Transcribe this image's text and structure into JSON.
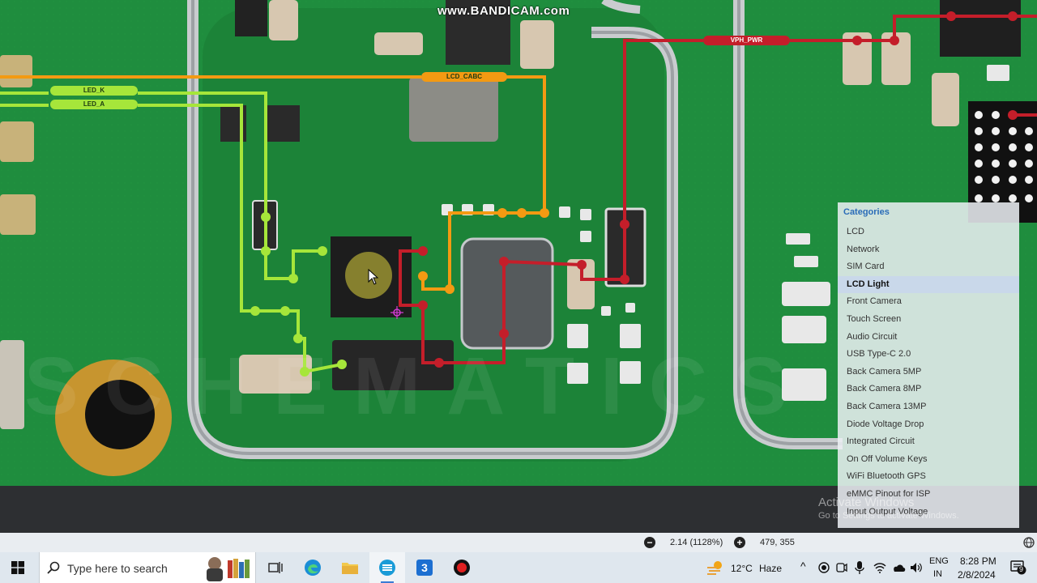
{
  "watermark": "www.BANDICAM.com",
  "background_watermark": "SCHEMATICS",
  "net_labels": {
    "led_k": "LED_K",
    "led_a": "LED_A",
    "lcd_cabc": "LCD_CABC",
    "vph_pwr": "VPH_PWR"
  },
  "colors": {
    "pcb": "#1e8a3c",
    "trace_orange": "#f39a12",
    "trace_green": "#a6e63a",
    "trace_red": "#c41e2a",
    "accent_blue": "#2a6cb8"
  },
  "categories": {
    "title": "Categories",
    "selected": "LCD Light",
    "items": [
      "LCD",
      "Network",
      "SIM Card",
      "LCD Light",
      "Front Camera",
      "Touch Screen",
      "Audio Circuit",
      "USB Type-C 2.0",
      "Back Camera 5MP",
      "Back Camera 8MP",
      "Back Camera 13MP",
      "Diode Voltage Drop",
      "Integrated Circuit",
      "On Off Volume Keys",
      "WiFi Bluetooth GPS",
      "eMMC Pinout for ISP",
      "Input Output Voltage"
    ]
  },
  "status_bar": {
    "zoom_out_icon": "minus-circle-icon",
    "zoom_in_icon": "plus-circle-icon",
    "zoom": "2.14 (1128%)",
    "coordinates": "479, 355"
  },
  "activate_windows": {
    "line1": "Activate Windows",
    "line2": "Go to Settings to activate Windows."
  },
  "taskbar": {
    "search_placeholder": "Type here to search",
    "apps": [
      "task-view-icon",
      "edge-icon",
      "file-explorer-icon",
      "schematics-app-icon",
      "app-3-icon",
      "record-icon"
    ],
    "weather": {
      "temp": "12°C",
      "condition": "Haze"
    },
    "language": {
      "lang": "ENG",
      "region": "IN"
    },
    "time": "8:28 PM",
    "date": "2/8/2024",
    "notification_count": "9"
  }
}
